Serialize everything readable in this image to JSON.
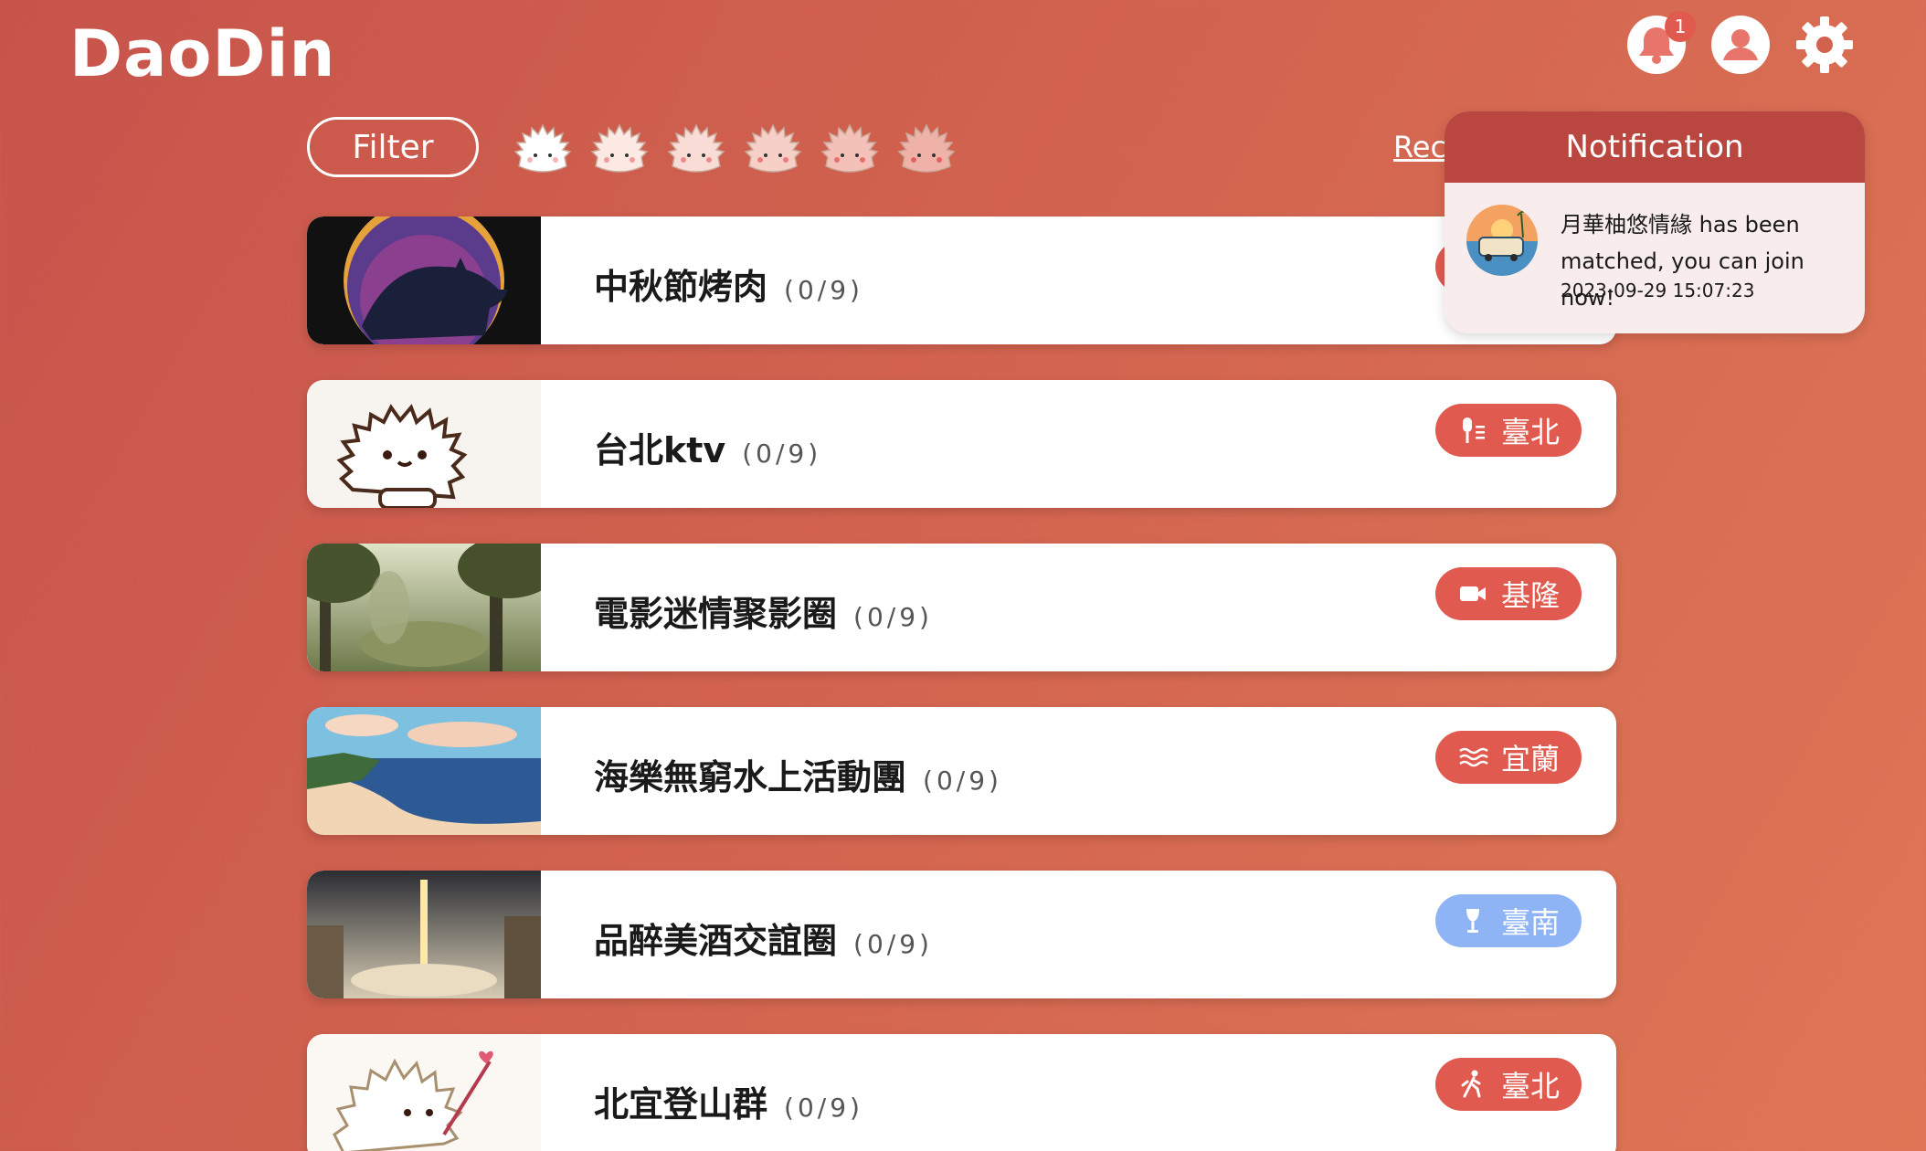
{
  "header": {
    "logo": "DaoDin",
    "notification_badge": "1"
  },
  "toolbar": {
    "filter_label": "Filter",
    "rec_link": "Rec"
  },
  "cards": [
    {
      "title": "中秋節烤肉",
      "count": "(0/9)",
      "tag_label": "",
      "tag_icon": "unknown",
      "tag_color": "#e05a4f"
    },
    {
      "title": "台北ktv",
      "count": "(0/9)",
      "tag_label": "臺北",
      "tag_icon": "microphone-icon",
      "tag_color": "#e05a4f"
    },
    {
      "title": "電影迷情聚影圈",
      "count": "(0/9)",
      "tag_label": "基隆",
      "tag_icon": "video-camera-icon",
      "tag_color": "#e05a4f"
    },
    {
      "title": "海樂無窮水上活動團",
      "count": "(0/9)",
      "tag_label": "宜蘭",
      "tag_icon": "waves-icon",
      "tag_color": "#e05a4f"
    },
    {
      "title": "品醉美酒交誼圈",
      "count": "(0/9)",
      "tag_label": "臺南",
      "tag_icon": "wine-glass-icon",
      "tag_color": "#8fb4f5"
    },
    {
      "title": "北宜登山群",
      "count": "(0/9)",
      "tag_label": "臺北",
      "tag_icon": "hiking-icon",
      "tag_color": "#e05a4f"
    }
  ],
  "notification": {
    "title": "Notification",
    "message": "月華柚悠情緣 has been matched, you can join now!",
    "time": "2023-09-29 15:07:23"
  },
  "colors": {
    "accent": "#e05a4f",
    "notification_header": "#b9463f",
    "blue_tag": "#8fb4f5"
  }
}
